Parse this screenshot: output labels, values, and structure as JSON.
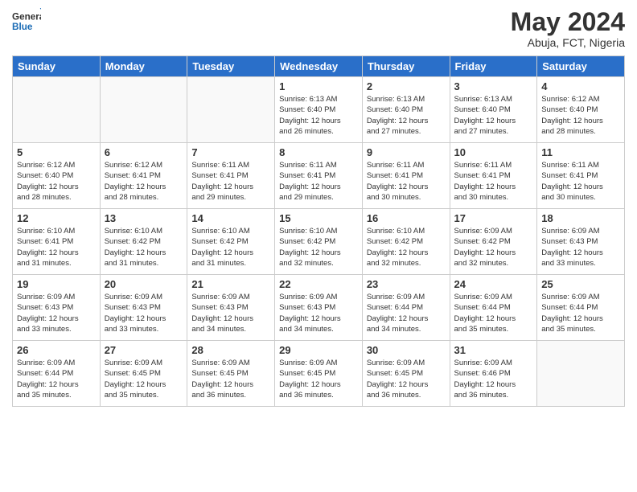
{
  "header": {
    "logo_line1": "General",
    "logo_line2": "Blue",
    "month": "May 2024",
    "location": "Abuja, FCT, Nigeria"
  },
  "days_of_week": [
    "Sunday",
    "Monday",
    "Tuesday",
    "Wednesday",
    "Thursday",
    "Friday",
    "Saturday"
  ],
  "weeks": [
    [
      {
        "day": "",
        "info": ""
      },
      {
        "day": "",
        "info": ""
      },
      {
        "day": "",
        "info": ""
      },
      {
        "day": "1",
        "info": "Sunrise: 6:13 AM\nSunset: 6:40 PM\nDaylight: 12 hours\nand 26 minutes."
      },
      {
        "day": "2",
        "info": "Sunrise: 6:13 AM\nSunset: 6:40 PM\nDaylight: 12 hours\nand 27 minutes."
      },
      {
        "day": "3",
        "info": "Sunrise: 6:13 AM\nSunset: 6:40 PM\nDaylight: 12 hours\nand 27 minutes."
      },
      {
        "day": "4",
        "info": "Sunrise: 6:12 AM\nSunset: 6:40 PM\nDaylight: 12 hours\nand 28 minutes."
      }
    ],
    [
      {
        "day": "5",
        "info": "Sunrise: 6:12 AM\nSunset: 6:40 PM\nDaylight: 12 hours\nand 28 minutes."
      },
      {
        "day": "6",
        "info": "Sunrise: 6:12 AM\nSunset: 6:41 PM\nDaylight: 12 hours\nand 28 minutes."
      },
      {
        "day": "7",
        "info": "Sunrise: 6:11 AM\nSunset: 6:41 PM\nDaylight: 12 hours\nand 29 minutes."
      },
      {
        "day": "8",
        "info": "Sunrise: 6:11 AM\nSunset: 6:41 PM\nDaylight: 12 hours\nand 29 minutes."
      },
      {
        "day": "9",
        "info": "Sunrise: 6:11 AM\nSunset: 6:41 PM\nDaylight: 12 hours\nand 30 minutes."
      },
      {
        "day": "10",
        "info": "Sunrise: 6:11 AM\nSunset: 6:41 PM\nDaylight: 12 hours\nand 30 minutes."
      },
      {
        "day": "11",
        "info": "Sunrise: 6:11 AM\nSunset: 6:41 PM\nDaylight: 12 hours\nand 30 minutes."
      }
    ],
    [
      {
        "day": "12",
        "info": "Sunrise: 6:10 AM\nSunset: 6:41 PM\nDaylight: 12 hours\nand 31 minutes."
      },
      {
        "day": "13",
        "info": "Sunrise: 6:10 AM\nSunset: 6:42 PM\nDaylight: 12 hours\nand 31 minutes."
      },
      {
        "day": "14",
        "info": "Sunrise: 6:10 AM\nSunset: 6:42 PM\nDaylight: 12 hours\nand 31 minutes."
      },
      {
        "day": "15",
        "info": "Sunrise: 6:10 AM\nSunset: 6:42 PM\nDaylight: 12 hours\nand 32 minutes."
      },
      {
        "day": "16",
        "info": "Sunrise: 6:10 AM\nSunset: 6:42 PM\nDaylight: 12 hours\nand 32 minutes."
      },
      {
        "day": "17",
        "info": "Sunrise: 6:09 AM\nSunset: 6:42 PM\nDaylight: 12 hours\nand 32 minutes."
      },
      {
        "day": "18",
        "info": "Sunrise: 6:09 AM\nSunset: 6:43 PM\nDaylight: 12 hours\nand 33 minutes."
      }
    ],
    [
      {
        "day": "19",
        "info": "Sunrise: 6:09 AM\nSunset: 6:43 PM\nDaylight: 12 hours\nand 33 minutes."
      },
      {
        "day": "20",
        "info": "Sunrise: 6:09 AM\nSunset: 6:43 PM\nDaylight: 12 hours\nand 33 minutes."
      },
      {
        "day": "21",
        "info": "Sunrise: 6:09 AM\nSunset: 6:43 PM\nDaylight: 12 hours\nand 34 minutes."
      },
      {
        "day": "22",
        "info": "Sunrise: 6:09 AM\nSunset: 6:43 PM\nDaylight: 12 hours\nand 34 minutes."
      },
      {
        "day": "23",
        "info": "Sunrise: 6:09 AM\nSunset: 6:44 PM\nDaylight: 12 hours\nand 34 minutes."
      },
      {
        "day": "24",
        "info": "Sunrise: 6:09 AM\nSunset: 6:44 PM\nDaylight: 12 hours\nand 35 minutes."
      },
      {
        "day": "25",
        "info": "Sunrise: 6:09 AM\nSunset: 6:44 PM\nDaylight: 12 hours\nand 35 minutes."
      }
    ],
    [
      {
        "day": "26",
        "info": "Sunrise: 6:09 AM\nSunset: 6:44 PM\nDaylight: 12 hours\nand 35 minutes."
      },
      {
        "day": "27",
        "info": "Sunrise: 6:09 AM\nSunset: 6:45 PM\nDaylight: 12 hours\nand 35 minutes."
      },
      {
        "day": "28",
        "info": "Sunrise: 6:09 AM\nSunset: 6:45 PM\nDaylight: 12 hours\nand 36 minutes."
      },
      {
        "day": "29",
        "info": "Sunrise: 6:09 AM\nSunset: 6:45 PM\nDaylight: 12 hours\nand 36 minutes."
      },
      {
        "day": "30",
        "info": "Sunrise: 6:09 AM\nSunset: 6:45 PM\nDaylight: 12 hours\nand 36 minutes."
      },
      {
        "day": "31",
        "info": "Sunrise: 6:09 AM\nSunset: 6:46 PM\nDaylight: 12 hours\nand 36 minutes."
      },
      {
        "day": "",
        "info": ""
      }
    ]
  ]
}
